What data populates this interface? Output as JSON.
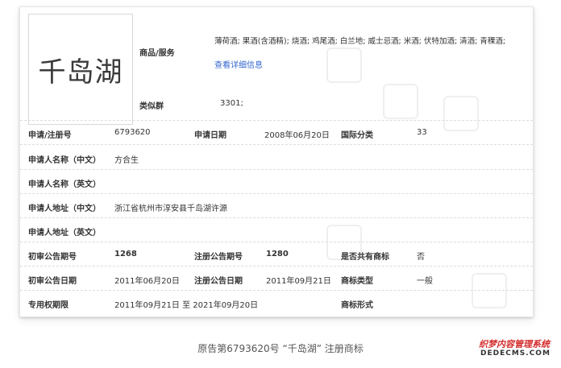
{
  "trademark": {
    "logo_text": "千岛湖",
    "goods_label": "商品/服务",
    "goods_value": "薄荷酒; 果酒(含酒精); 烧酒; 鸡尾酒; 白兰地; 威士忌酒; 米酒; 伏特加酒; 清酒; 青稞酒;",
    "detail_link": "查看详细信息",
    "similar_group_label": "类似群",
    "similar_group_value": "3301;"
  },
  "rows": {
    "reg_no_label": "申请/注册号",
    "reg_no_value": "6793620",
    "apply_date_label": "申请日期",
    "apply_date_value": "2008年06月20日",
    "intl_class_label": "国际分类",
    "intl_class_value": "33",
    "applicant_cn_label": "申请人名称（中文）",
    "applicant_cn_value": "方合生",
    "applicant_en_label": "申请人名称（英文）",
    "applicant_en_value": "",
    "address_cn_label": "申请人地址（中文）",
    "address_cn_value": "浙江省杭州市淳安县千岛湖许源",
    "address_en_label": "申请人地址（英文）",
    "address_en_value": "",
    "prelim_issue_label": "初审公告期号",
    "prelim_issue_value": "1268",
    "reg_issue_label": "注册公告期号",
    "reg_issue_value": "1280",
    "shared_label": "是否共有商标",
    "shared_value": "否",
    "prelim_date_label": "初审公告日期",
    "prelim_date_value": "2011年06月20日",
    "reg_date_label": "注册公告日期",
    "reg_date_value": "2011年09月21日",
    "type_label": "商标类型",
    "type_value": "一般",
    "period_label": "专用权期限",
    "period_value": "2011年09月21日 至 2021年09月20日",
    "form_label": "商标形式",
    "form_value": ""
  },
  "caption": "原告第6793620号 “千岛湖” 注册商标",
  "watermark": {
    "top": "织梦内容管理系统",
    "bottom": "DEDECMS.COM"
  },
  "colors": {
    "link": "#3366cc",
    "watermark_red": "#d42a2a"
  }
}
